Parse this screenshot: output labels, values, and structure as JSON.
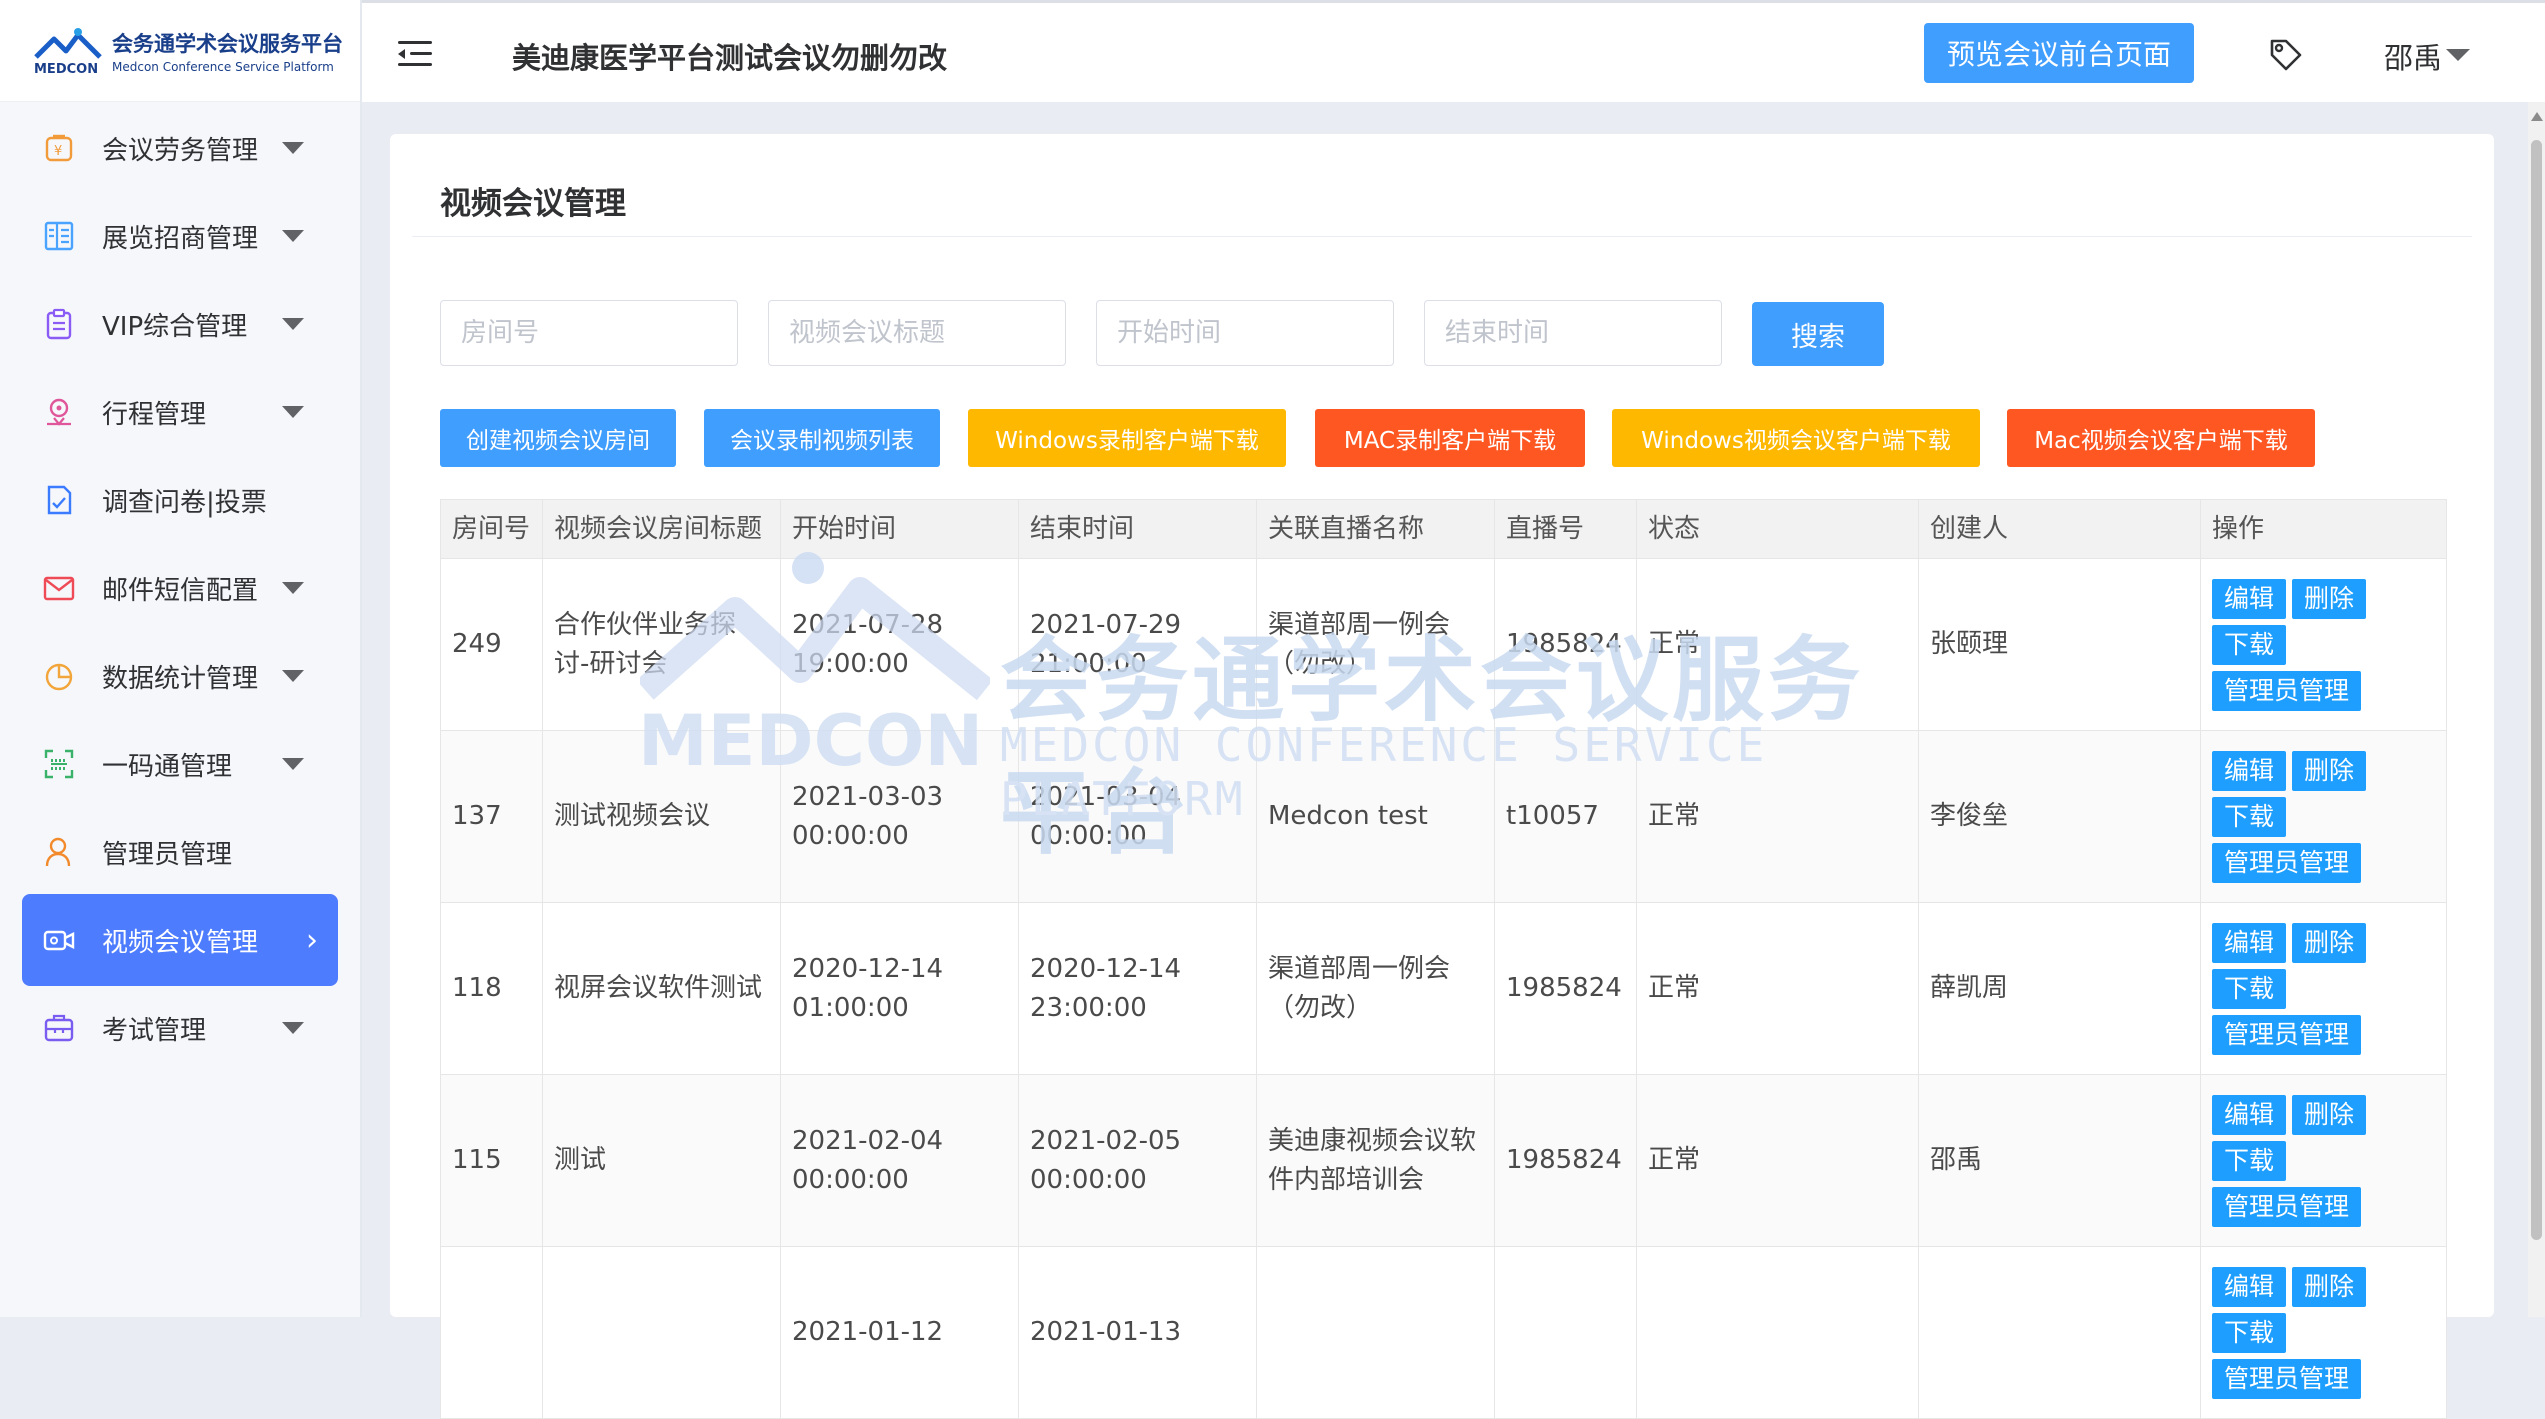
{
  "brand": {
    "name_cn": "会务通学术会议服务平台",
    "name_en_small": "Medcon Conference Service Platform",
    "logo_word": "MEDCON"
  },
  "header": {
    "title": "美迪康医学平台测试会议勿删勿改",
    "preview_button": "预览会议前台页面",
    "user_name": "邵禹"
  },
  "sidebar": {
    "items": [
      {
        "label": "会议劳务管理",
        "icon": "money-bag-icon",
        "has_caret": true
      },
      {
        "label": "展览招商管理",
        "icon": "exhibition-icon",
        "has_caret": true
      },
      {
        "label": "VIP综合管理",
        "icon": "clipboard-icon",
        "has_caret": true
      },
      {
        "label": "行程管理",
        "icon": "location-pin-icon",
        "has_caret": true
      },
      {
        "label": "调查问卷|投票",
        "icon": "survey-icon",
        "has_caret": false
      },
      {
        "label": "邮件短信配置",
        "icon": "mail-icon",
        "has_caret": true
      },
      {
        "label": "数据统计管理",
        "icon": "pie-chart-icon",
        "has_caret": true
      },
      {
        "label": "一码通管理",
        "icon": "scan-code-icon",
        "has_caret": true
      },
      {
        "label": "管理员管理",
        "icon": "user-icon",
        "has_caret": false
      },
      {
        "label": "视频会议管理",
        "icon": "video-camera-icon",
        "has_caret": false,
        "active": true
      },
      {
        "label": "考试管理",
        "icon": "exam-icon",
        "has_caret": true
      }
    ]
  },
  "page": {
    "title": "视频会议管理",
    "filters": {
      "room_placeholder": "房间号",
      "title_placeholder": "视频会议标题",
      "start_placeholder": "开始时间",
      "end_placeholder": "结束时间",
      "search_label": "搜索"
    },
    "actions": [
      {
        "label": "创建视频会议房间",
        "color": "#409eff"
      },
      {
        "label": "会议录制视频列表",
        "color": "#409eff"
      },
      {
        "label": "Windows录制客户端下载",
        "color": "#ffb800"
      },
      {
        "label": "MAC录制客户端下载",
        "color": "#ff5722"
      },
      {
        "label": "Windows视频会议客户端下载",
        "color": "#ffb800"
      },
      {
        "label": "Mac视频会议客户端下载",
        "color": "#ff5722"
      }
    ]
  },
  "table": {
    "columns": [
      "房间号",
      "视频会议房间标题",
      "开始时间",
      "结束时间",
      "关联直播名称",
      "直播号",
      "状态",
      "创建人",
      "操作"
    ],
    "op_labels": {
      "edit": "编辑",
      "delete": "删除",
      "download": "下载",
      "admin": "管理员管理"
    },
    "rows": [
      {
        "room": "249",
        "title": "合作伙伴业务探讨-研讨会",
        "start_date": "2021-07-28",
        "start_time": "19:00:00",
        "end_date": "2021-07-29",
        "end_time": "21:00:00",
        "live_name": "渠道部周一例会（勿改）",
        "live_no": "1985824",
        "status": "正常",
        "creator": "张颐理"
      },
      {
        "room": "137",
        "title": "测试视频会议",
        "start_date": "2021-03-03",
        "start_time": "00:00:00",
        "end_date": "2021-03-04",
        "end_time": "00:00:00",
        "live_name": "Medcon test",
        "live_no": "t10057",
        "status": "正常",
        "creator": "李俊垒"
      },
      {
        "room": "118",
        "title": "视屏会议软件测试",
        "start_date": "2020-12-14",
        "start_time": "01:00:00",
        "end_date": "2020-12-14",
        "end_time": "23:00:00",
        "live_name": "渠道部周一例会（勿改）",
        "live_no": "1985824",
        "status": "正常",
        "creator": "薛凯周"
      },
      {
        "room": "115",
        "title": "测试",
        "start_date": "2021-02-04",
        "start_time": "00:00:00",
        "end_date": "2021-02-05",
        "end_time": "00:00:00",
        "live_name": "美迪康视频会议软件内部培训会",
        "live_no": "1985824",
        "status": "正常",
        "creator": "邵禹"
      },
      {
        "room": "",
        "title": "",
        "start_date": "2021-01-12",
        "start_time": "",
        "end_date": "2021-01-13",
        "end_time": "",
        "live_name": "",
        "live_no": "",
        "status": "",
        "creator": ""
      }
    ]
  },
  "watermark": {
    "cn": "会务通学术会议服务平台",
    "en_big": "MEDCON",
    "en_small": "MEDCON CONFERENCE SERVICE PLATFORM"
  }
}
